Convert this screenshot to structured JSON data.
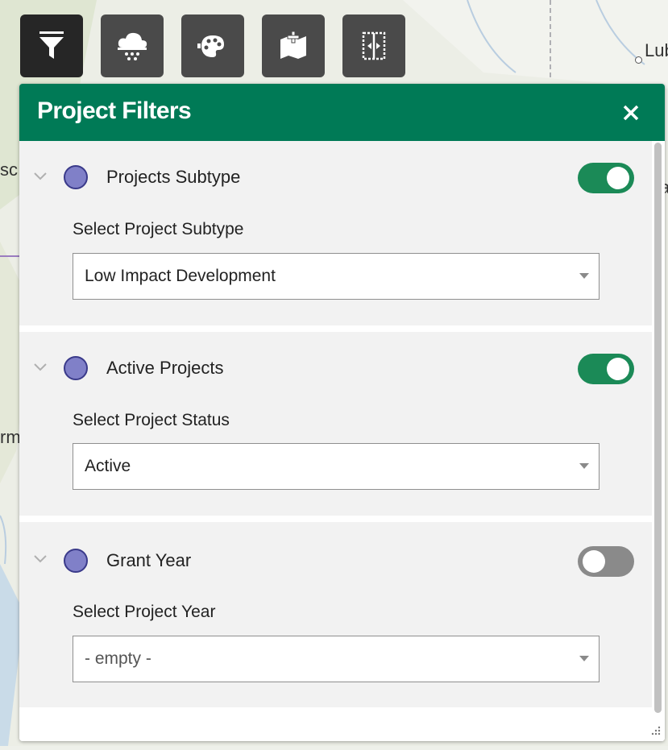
{
  "map": {
    "place_labels": [
      "Lub",
      "sc",
      "a",
      "rm"
    ]
  },
  "toolbar": {
    "tools": [
      {
        "icon": "filter-icon",
        "active": true
      },
      {
        "icon": "rain-cloud-icon",
        "active": false
      },
      {
        "icon": "map-palette-icon",
        "active": false
      },
      {
        "icon": "add-data-icon",
        "active": false
      },
      {
        "icon": "swipe-compare-icon",
        "active": false
      }
    ]
  },
  "panel": {
    "title": "Project Filters",
    "close_icon": "close-icon",
    "header_color": "#007a56",
    "sections": [
      {
        "title": "Projects Subtype",
        "enabled": true,
        "field_label": "Select Project Subtype",
        "selected_value": "Low Impact Development"
      },
      {
        "title": "Active Projects",
        "enabled": true,
        "field_label": "Select Project Status",
        "selected_value": "Active"
      },
      {
        "title": "Grant Year",
        "enabled": false,
        "field_label": "Select Project Year",
        "selected_value": "- empty -"
      }
    ]
  },
  "colors": {
    "toggle_on": "#1b8a57",
    "toggle_off": "#8a8a8a",
    "layer_dot": "#8080c8"
  }
}
